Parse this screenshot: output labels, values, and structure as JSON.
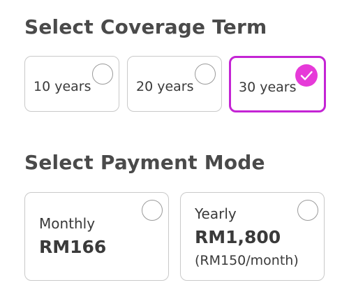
{
  "coverage": {
    "heading": "Select Coverage Term",
    "options": [
      {
        "label": "10 years",
        "selected": false
      },
      {
        "label": "20 years",
        "selected": false
      },
      {
        "label": "30 years",
        "selected": true
      }
    ]
  },
  "payment": {
    "heading": "Select Payment Mode",
    "options": [
      {
        "label": "Monthly",
        "price": "RM166",
        "selected": false
      },
      {
        "label": "Yearly",
        "price": "RM1,800",
        "note": "(RM150/month)",
        "selected": false
      }
    ]
  },
  "colors": {
    "accent": "#c424d4",
    "check_fill": "#e63ad8",
    "border": "#c9c9c9",
    "text": "#3a3a3a"
  },
  "icons": {
    "radio_unchecked": "radio-unchecked-icon",
    "radio_checked": "checkmark-circle-icon"
  }
}
